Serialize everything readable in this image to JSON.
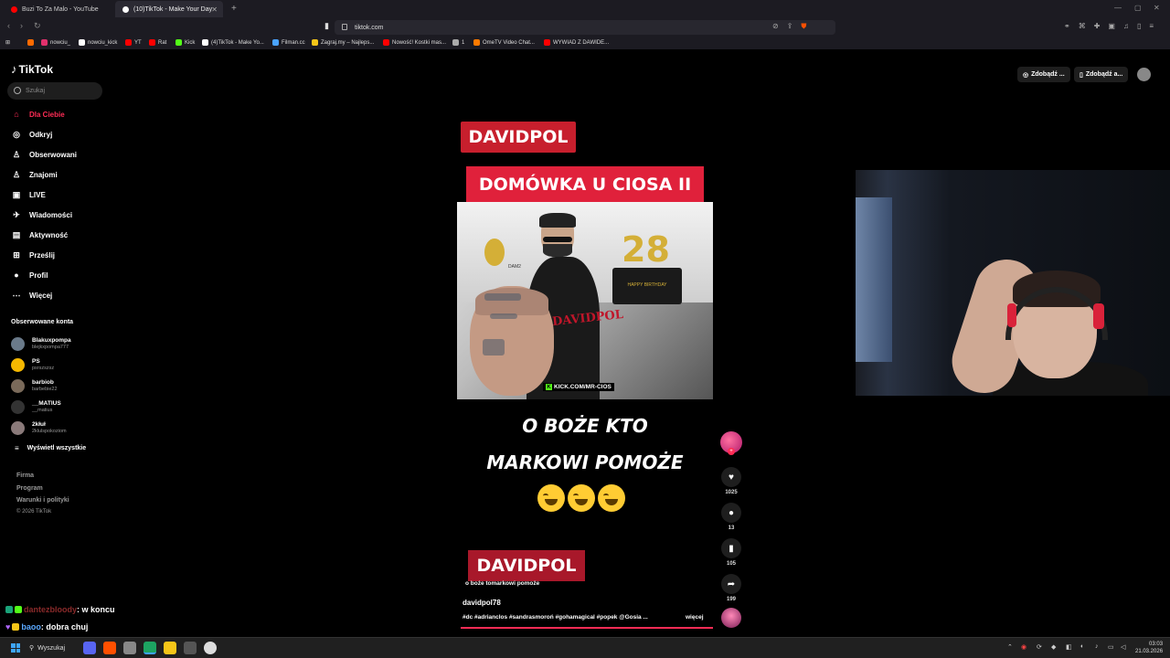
{
  "browser": {
    "tabs": [
      {
        "label": "Buzi To Za Malo - YouTube",
        "color": "#ff0000"
      },
      {
        "label": "(10)TikTok - Make Your Day",
        "color": "#ffffff"
      }
    ],
    "url": "tiktok.com",
    "bookmarks": [
      {
        "label": "nowciu_",
        "color": "#e1306c"
      },
      {
        "label": "nowciu_kick",
        "color": "#ffffff"
      },
      {
        "label": "YT",
        "color": "#ff0000"
      },
      {
        "label": "Rat",
        "color": "#ff0000"
      },
      {
        "label": "Kick",
        "color": "#53fc18"
      },
      {
        "label": "(4)TikTok - Make Yo...",
        "color": "#ffffff"
      },
      {
        "label": "Filman.cc",
        "color": "#4aa3ff"
      },
      {
        "label": "Zagraj.my – Najleps...",
        "color": "#f5c518"
      },
      {
        "label": "Nowość! Kostki mas...",
        "color": "#ff0000"
      },
      {
        "label": "1",
        "color": "#aaaaaa"
      },
      {
        "label": "OmeTV Video Chat...",
        "color": "#ff7a00"
      },
      {
        "label": "WYWIAD Z DAWIDE...",
        "color": "#ff0000"
      }
    ]
  },
  "tiktok": {
    "logo": "TikTok",
    "search_placeholder": "Szukaj",
    "nav": [
      {
        "label": "Dla Ciebie",
        "icon": "home-icon",
        "glyph": "⌂"
      },
      {
        "label": "Odkryj",
        "icon": "compass-icon",
        "glyph": "◎"
      },
      {
        "label": "Obserwowani",
        "icon": "user-plus-icon",
        "glyph": "♙"
      },
      {
        "label": "Znajomi",
        "icon": "friends-icon",
        "glyph": "♙"
      },
      {
        "label": "LIVE",
        "icon": "live-icon",
        "glyph": "▣"
      },
      {
        "label": "Wiadomości",
        "icon": "messages-icon",
        "glyph": "✈"
      },
      {
        "label": "Aktywność",
        "icon": "activity-icon",
        "glyph": "▤"
      },
      {
        "label": "Prześlij",
        "icon": "upload-icon",
        "glyph": "⊞"
      },
      {
        "label": "Profil",
        "icon": "profile-icon",
        "glyph": "●"
      },
      {
        "label": "Więcej",
        "icon": "more-icon",
        "glyph": "⋯"
      }
    ],
    "followed_title": "Obserwowane konta",
    "followed": [
      {
        "name": "Blakuxpompa",
        "handle": "blejkxpompa777"
      },
      {
        "name": "PS",
        "handle": "psrszszsz"
      },
      {
        "name": "barbiob",
        "handle": "barbebie22"
      },
      {
        "name": "__MATIUS",
        "handle": "__matius"
      },
      {
        "name": "2kłuł",
        "handle": "2klulspokoziom"
      }
    ],
    "show_all": "Wyświetl wszystkie",
    "footer": [
      "Firma",
      "Program",
      "Warunki i polityki"
    ],
    "copyright": "© 2026 TikTok",
    "top_buttons": [
      "Zdobądź ...",
      "Zdobądź a..."
    ]
  },
  "video": {
    "label_top": "DAVIDPOL",
    "label_title": "DOMÓWKA U CIOSA II",
    "in_video_number": "28",
    "in_video_banner": "HAPPY BIRTHDAY",
    "in_video_logo": "DAVIDPOL",
    "in_video_small": "DAM2",
    "kick_text": "KICK.COM/MR-CIOS",
    "headline_1": "O BOŻE KTO",
    "headline_2": "MARKOWI POMOŻE",
    "label_bottom": "DAVIDPOL",
    "caption": "o boże tomarkowi pomoże",
    "author": "davidpol78",
    "hashtags": "#dc #adrianclos #sandrasmoroń #gohamagical #popek @Gosia ...",
    "more": "więcej",
    "likes": "1025",
    "comments": "13",
    "saves": "105",
    "shares": "199"
  },
  "chat": [
    {
      "user": "dantezbloody",
      "message": ": w koncu",
      "color": "#8a2a2a"
    },
    {
      "user": "baoo",
      "message": ": dobra chuj",
      "color": "#5aa8ff"
    }
  ],
  "taskbar": {
    "search": "Wyszukaj",
    "time": "03:03",
    "date": "21.03.2026"
  }
}
